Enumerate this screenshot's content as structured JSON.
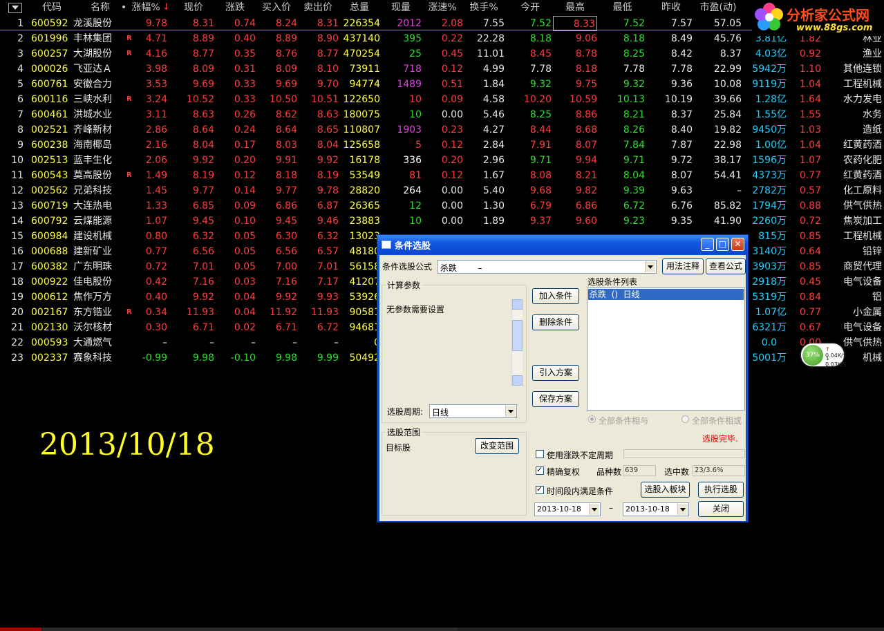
{
  "columns": [
    "代码",
    "名称",
    "•",
    "涨幅%",
    "现价",
    "涨跌",
    "买入价",
    "卖出价",
    "总量",
    "现量",
    "涨速%",
    "换手%",
    "今开",
    "最高",
    "最低",
    "昨收",
    "市盈(动)",
    "",
    "",
    ""
  ],
  "sort_marker": "↓",
  "colors": {
    "up": "#ff3c3c",
    "down": "#2ce02c",
    "flat": "#e6e6e6",
    "code": "#ffff40",
    "name": "#e6e6e6",
    "volume": "#ffff40",
    "cur_red": "#ff3c3c",
    "cur_purple": "#e040e0",
    "cur_white": "#ffffff",
    "cyan": "#20d0ff"
  },
  "rows": [
    {
      "n": "1",
      "code": "600592",
      "name": "龙溪股份",
      "r": "",
      "chg_pct": "9.78",
      "price": "8.31",
      "chg": "0.74",
      "bid": "8.24",
      "ask": "8.31",
      "vol": "226354",
      "cur": "2012",
      "cur_c": "purple",
      "speed": "2.08",
      "turn": "7.55",
      "open": "7.52",
      "high": "8.33",
      "low": "7.52",
      "prev": "7.57",
      "pe": "57.05",
      "amt": "",
      "amt_u": "",
      "ratio": "",
      "ind": "",
      "oc": "down",
      "hc": "up",
      "lc": "down",
      "pc": "up"
    },
    {
      "n": "2",
      "code": "601996",
      "name": "丰林集团",
      "r": "R",
      "chg_pct": "4.71",
      "price": "8.89",
      "chg": "0.40",
      "bid": "8.89",
      "ask": "8.90",
      "vol": "437140",
      "cur": "395",
      "cur_c": "green",
      "speed": "0.22",
      "turn": "22.28",
      "open": "8.18",
      "high": "9.06",
      "low": "8.18",
      "prev": "8.49",
      "pe": "45.76",
      "amt": "3.81",
      "amt_u": "亿",
      "ratio": "1.82",
      "ind": "林业",
      "oc": "down",
      "hc": "up",
      "lc": "down",
      "pc": "up"
    },
    {
      "n": "3",
      "code": "600257",
      "name": "大湖股份",
      "r": "R",
      "chg_pct": "4.16",
      "price": "8.77",
      "chg": "0.35",
      "bid": "8.76",
      "ask": "8.77",
      "vol": "470254",
      "cur": "25",
      "cur_c": "green",
      "speed": "0.45",
      "turn": "11.01",
      "open": "8.45",
      "high": "8.78",
      "low": "8.25",
      "prev": "8.42",
      "pe": "8.37",
      "amt": "4.03",
      "amt_u": "亿",
      "ratio": "0.92",
      "ind": "渔业",
      "oc": "up",
      "hc": "up",
      "lc": "down",
      "pc": "up"
    },
    {
      "n": "4",
      "code": "000026",
      "name": "飞亚达Ａ",
      "r": "",
      "chg_pct": "3.98",
      "price": "8.09",
      "chg": "0.31",
      "bid": "8.09",
      "ask": "8.10",
      "vol": "73911",
      "cur": "718",
      "cur_c": "purple",
      "speed": "0.12",
      "turn": "4.99",
      "open": "7.78",
      "high": "8.18",
      "low": "7.78",
      "prev": "7.78",
      "pe": "22.99",
      "amt": "5942",
      "amt_u": "万",
      "ratio": "1.10",
      "ind": "其他连锁",
      "oc": "flat",
      "hc": "up",
      "lc": "flat",
      "pc": "up"
    },
    {
      "n": "5",
      "code": "600761",
      "name": "安徽合力",
      "r": "",
      "chg_pct": "3.53",
      "price": "9.69",
      "chg": "0.33",
      "bid": "9.69",
      "ask": "9.70",
      "vol": "94774",
      "cur": "1489",
      "cur_c": "purple",
      "speed": "0.51",
      "turn": "1.84",
      "open": "9.32",
      "high": "9.75",
      "low": "9.32",
      "prev": "9.36",
      "pe": "10.08",
      "amt": "9119",
      "amt_u": "万",
      "ratio": "1.04",
      "ind": "工程机械",
      "oc": "down",
      "hc": "up",
      "lc": "down",
      "pc": "up"
    },
    {
      "n": "6",
      "code": "600116",
      "name": "三峡水利",
      "r": "R",
      "chg_pct": "3.24",
      "price": "10.52",
      "chg": "0.33",
      "bid": "10.50",
      "ask": "10.51",
      "vol": "122650",
      "cur": "10",
      "cur_c": "red",
      "speed": "0.09",
      "turn": "4.58",
      "open": "10.20",
      "high": "10.59",
      "low": "10.13",
      "prev": "10.19",
      "pe": "39.66",
      "amt": "1.28",
      "amt_u": "亿",
      "ratio": "1.64",
      "ind": "水力发电",
      "oc": "up",
      "hc": "up",
      "lc": "down",
      "pc": "up"
    },
    {
      "n": "7",
      "code": "600461",
      "name": "洪城水业",
      "r": "",
      "chg_pct": "3.11",
      "price": "8.63",
      "chg": "0.26",
      "bid": "8.62",
      "ask": "8.63",
      "vol": "180075",
      "cur": "10",
      "cur_c": "green",
      "speed": "0.00",
      "turn": "5.46",
      "open": "8.25",
      "high": "8.86",
      "low": "8.21",
      "prev": "8.37",
      "pe": "25.84",
      "amt": "1.55",
      "amt_u": "亿",
      "ratio": "1.55",
      "ind": "水务",
      "oc": "down",
      "hc": "up",
      "lc": "down",
      "pc": "up"
    },
    {
      "n": "8",
      "code": "002521",
      "name": "齐峰新材",
      "r": "",
      "chg_pct": "2.86",
      "price": "8.64",
      "chg": "0.24",
      "bid": "8.64",
      "ask": "8.65",
      "vol": "110807",
      "cur": "1903",
      "cur_c": "purple",
      "speed": "0.23",
      "turn": "4.27",
      "open": "8.44",
      "high": "8.68",
      "low": "8.26",
      "prev": "8.40",
      "pe": "19.82",
      "amt": "9450",
      "amt_u": "万",
      "ratio": "1.03",
      "ind": "造纸",
      "oc": "up",
      "hc": "up",
      "lc": "down",
      "pc": "up"
    },
    {
      "n": "9",
      "code": "600238",
      "name": "海南椰岛",
      "r": "",
      "chg_pct": "2.16",
      "price": "8.04",
      "chg": "0.17",
      "bid": "8.03",
      "ask": "8.04",
      "vol": "125658",
      "cur": "5",
      "cur_c": "red",
      "speed": "0.12",
      "turn": "2.84",
      "open": "7.91",
      "high": "8.07",
      "low": "7.84",
      "prev": "7.87",
      "pe": "22.98",
      "amt": "1.00",
      "amt_u": "亿",
      "ratio": "1.04",
      "ind": "红黄药酒",
      "oc": "up",
      "hc": "up",
      "lc": "down",
      "pc": "up"
    },
    {
      "n": "10",
      "code": "002513",
      "name": "蓝丰生化",
      "r": "",
      "chg_pct": "2.06",
      "price": "9.92",
      "chg": "0.20",
      "bid": "9.91",
      "ask": "9.92",
      "vol": "16178",
      "cur": "336",
      "cur_c": "white",
      "speed": "0.20",
      "turn": "2.96",
      "open": "9.71",
      "high": "9.94",
      "low": "9.71",
      "prev": "9.72",
      "pe": "38.17",
      "amt": "1596",
      "amt_u": "万",
      "ratio": "1.07",
      "ind": "农药化肥",
      "oc": "down",
      "hc": "up",
      "lc": "down",
      "pc": "up"
    },
    {
      "n": "11",
      "code": "600543",
      "name": "莫高股份",
      "r": "R",
      "chg_pct": "1.49",
      "price": "8.19",
      "chg": "0.12",
      "bid": "8.18",
      "ask": "8.19",
      "vol": "53549",
      "cur": "81",
      "cur_c": "red",
      "speed": "0.12",
      "turn": "1.67",
      "open": "8.08",
      "high": "8.21",
      "low": "8.04",
      "prev": "8.07",
      "pe": "54.41",
      "amt": "4373",
      "amt_u": "万",
      "ratio": "0.77",
      "ind": "红黄药酒",
      "oc": "up",
      "hc": "up",
      "lc": "down",
      "pc": "up"
    },
    {
      "n": "12",
      "code": "002562",
      "name": "兄弟科技",
      "r": "",
      "chg_pct": "1.45",
      "price": "9.77",
      "chg": "0.14",
      "bid": "9.77",
      "ask": "9.78",
      "vol": "28820",
      "cur": "264",
      "cur_c": "white",
      "speed": "0.00",
      "turn": "5.40",
      "open": "9.68",
      "high": "9.82",
      "low": "9.39",
      "prev": "9.63",
      "pe": "–",
      "amt": "2782",
      "amt_u": "万",
      "ratio": "0.57",
      "ind": "化工原料",
      "oc": "up",
      "hc": "up",
      "lc": "down",
      "pc": "up"
    },
    {
      "n": "13",
      "code": "600719",
      "name": "大连热电",
      "r": "",
      "chg_pct": "1.33",
      "price": "6.85",
      "chg": "0.09",
      "bid": "6.86",
      "ask": "6.87",
      "vol": "26365",
      "cur": "12",
      "cur_c": "green",
      "speed": "0.00",
      "turn": "1.30",
      "open": "6.79",
      "high": "6.86",
      "low": "6.72",
      "prev": "6.76",
      "pe": "85.82",
      "amt": "1794",
      "amt_u": "万",
      "ratio": "0.88",
      "ind": "供气供热",
      "oc": "up",
      "hc": "up",
      "lc": "down",
      "pc": "up"
    },
    {
      "n": "14",
      "code": "600792",
      "name": "云煤能源",
      "r": "",
      "chg_pct": "1.07",
      "price": "9.45",
      "chg": "0.10",
      "bid": "9.45",
      "ask": "9.46",
      "vol": "23883",
      "cur": "10",
      "cur_c": "green",
      "speed": "0.00",
      "turn": "1.89",
      "open": "9.37",
      "high": "9.60",
      "low": "9.23",
      "prev": "9.35",
      "pe": "41.90",
      "amt": "2260",
      "amt_u": "万",
      "ratio": "0.72",
      "ind": "焦炭加工",
      "oc": "up",
      "hc": "up",
      "lc": "down",
      "pc": "up"
    },
    {
      "n": "15",
      "code": "600984",
      "name": "建设机械",
      "r": "",
      "chg_pct": "0.80",
      "price": "6.32",
      "chg": "0.05",
      "bid": "6.30",
      "ask": "6.32",
      "vol": "13023",
      "cur": "",
      "cur_c": "green",
      "speed": "",
      "turn": "",
      "open": "",
      "high": "",
      "low": "",
      "prev": "",
      "pe": "",
      "amt": "815",
      "amt_u": "万",
      "ratio": "0.85",
      "ind": "工程机械",
      "oc": "up",
      "hc": "up",
      "lc": "down",
      "pc": "up"
    },
    {
      "n": "16",
      "code": "000688",
      "name": "建新矿业",
      "r": "",
      "chg_pct": "0.77",
      "price": "6.56",
      "chg": "0.05",
      "bid": "6.56",
      "ask": "6.57",
      "vol": "48180",
      "cur": "",
      "cur_c": "green",
      "speed": "",
      "turn": "",
      "open": "",
      "high": "",
      "low": "",
      "prev": "",
      "pe": "",
      "amt": "3140",
      "amt_u": "万",
      "ratio": "0.64",
      "ind": "铅锌",
      "oc": "up",
      "hc": "up",
      "lc": "down",
      "pc": "up"
    },
    {
      "n": "17",
      "code": "600382",
      "name": "广东明珠",
      "r": "",
      "chg_pct": "0.72",
      "price": "7.01",
      "chg": "0.05",
      "bid": "7.00",
      "ask": "7.01",
      "vol": "56158",
      "cur": "",
      "cur_c": "green",
      "speed": "",
      "turn": "",
      "open": "",
      "high": "",
      "low": "",
      "prev": "",
      "pe": "",
      "amt": "3903",
      "amt_u": "万",
      "ratio": "0.85",
      "ind": "商贸代理",
      "oc": "up",
      "hc": "up",
      "lc": "down",
      "pc": "up"
    },
    {
      "n": "18",
      "code": "000922",
      "name": "佳电股份",
      "r": "",
      "chg_pct": "0.42",
      "price": "7.16",
      "chg": "0.03",
      "bid": "7.16",
      "ask": "7.17",
      "vol": "41207",
      "cur": "",
      "cur_c": "green",
      "speed": "",
      "turn": "",
      "open": "",
      "high": "",
      "low": "",
      "prev": "",
      "pe": "",
      "amt": "2918",
      "amt_u": "万",
      "ratio": "0.45",
      "ind": "电气设备",
      "oc": "up",
      "hc": "up",
      "lc": "down",
      "pc": "up"
    },
    {
      "n": "19",
      "code": "000612",
      "name": "焦作万方",
      "r": "",
      "chg_pct": "0.40",
      "price": "9.92",
      "chg": "0.04",
      "bid": "9.92",
      "ask": "9.93",
      "vol": "53926",
      "cur": "",
      "cur_c": "green",
      "speed": "",
      "turn": "",
      "open": "",
      "high": "",
      "low": "",
      "prev": "",
      "pe": "",
      "amt": "5319",
      "amt_u": "万",
      "ratio": "0.84",
      "ind": "铝",
      "oc": "up",
      "hc": "up",
      "lc": "down",
      "pc": "up"
    },
    {
      "n": "20",
      "code": "002167",
      "name": "东方锆业",
      "r": "R",
      "chg_pct": "0.34",
      "price": "11.93",
      "chg": "0.04",
      "bid": "11.92",
      "ask": "11.93",
      "vol": "90581",
      "cur": "",
      "cur_c": "green",
      "speed": "",
      "turn": "",
      "open": "",
      "high": "",
      "low": "",
      "prev": "",
      "pe": "",
      "amt": "1.07",
      "amt_u": "亿",
      "ratio": "0.77",
      "ind": "小金属",
      "oc": "up",
      "hc": "up",
      "lc": "down",
      "pc": "up"
    },
    {
      "n": "21",
      "code": "002130",
      "name": "沃尔核材",
      "r": "",
      "chg_pct": "0.30",
      "price": "6.71",
      "chg": "0.02",
      "bid": "6.71",
      "ask": "6.72",
      "vol": "94681",
      "cur": "",
      "cur_c": "green",
      "speed": "",
      "turn": "",
      "open": "",
      "high": "",
      "low": "",
      "prev": "",
      "pe": "",
      "amt": "6321",
      "amt_u": "万",
      "ratio": "0.67",
      "ind": "电气设备",
      "oc": "up",
      "hc": "up",
      "lc": "down",
      "pc": "up"
    },
    {
      "n": "22",
      "code": "000593",
      "name": "大通燃气",
      "r": "",
      "chg_pct": "–",
      "price": "–",
      "chg": "–",
      "bid": "–",
      "ask": "–",
      "vol": "0",
      "cur": "",
      "cur_c": "green",
      "speed": "",
      "turn": "",
      "open": "",
      "high": "",
      "low": "",
      "prev": "",
      "pe": "",
      "amt": "0.0",
      "amt_u": "",
      "ratio": "0.00",
      "ind": "供气供热",
      "oc": "up",
      "hc": "up",
      "lc": "down",
      "pc": "up"
    },
    {
      "n": "23",
      "code": "002337",
      "name": "赛象科技",
      "r": "",
      "chg_pct": "-0.99",
      "price": "9.98",
      "chg": "-0.10",
      "bid": "9.98",
      "ask": "9.99",
      "vol": "50492",
      "cur": "",
      "cur_c": "green",
      "speed": "",
      "turn": "",
      "open": "",
      "high": "",
      "low": "",
      "prev": "",
      "pe": "",
      "amt": "5001",
      "amt_u": "万",
      "ratio": "",
      "ind": "机械",
      "oc": "up",
      "hc": "up",
      "lc": "down",
      "pc": "up"
    }
  ],
  "logo": {
    "title": "分析家公式网",
    "url": "www.88gs.com"
  },
  "big_date": "2013/10/18",
  "net_widget": {
    "pct": "37%",
    "up": "0.04K/S",
    "down": "0.03K/S"
  },
  "dialog": {
    "title": "条件选股",
    "formula_label": "条件选股公式",
    "formula_value": "杀跌        –",
    "usage_btn": "用法注释",
    "view_btn": "查看公式",
    "params_group": "计算参数",
    "params_text": "无参数需要设置",
    "period_label": "选股周期:",
    "period_value": "日线",
    "add_btn": "加入条件",
    "del_btn": "删除条件",
    "import_btn": "引入方案",
    "save_btn": "保存方案",
    "cond_list_label": "选股条件列表",
    "cond_items": [
      "杀跌  ()  日线"
    ],
    "radio_and": "全部条件相与",
    "radio_or": "全部条件相或",
    "status": "选股完毕.",
    "range_group": "选股范围",
    "range_text": "目标股",
    "change_range_btn": "改变范围",
    "use_range_cb": "使用涨跌不定周期",
    "exact_cb": "精确复权",
    "count_label": "品种数",
    "count_value": "639",
    "picked_label": "选中数",
    "picked_value": "23/3.6%",
    "period_cb": "时间段内满足条件",
    "to_block_btn": "选股入板块",
    "run_btn": "执行选股",
    "date_from": "2013-10-18",
    "dash": "–",
    "date_to": "2013-10-18",
    "close_btn": "关闭"
  }
}
